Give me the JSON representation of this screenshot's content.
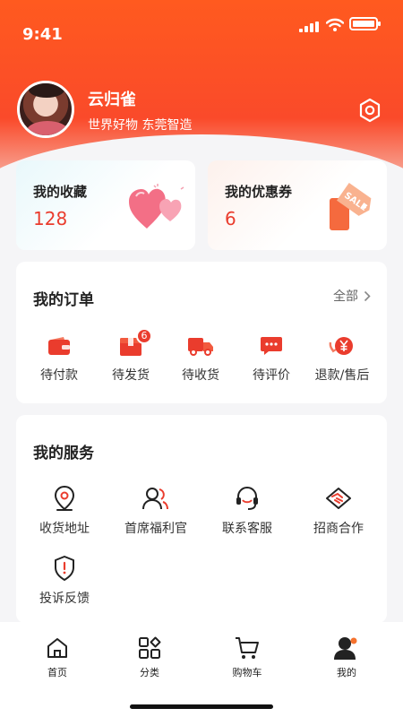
{
  "status_bar": {
    "time": "9:41"
  },
  "profile": {
    "name": "云归雀",
    "slogan": "世界好物 东莞智造"
  },
  "favorites": {
    "title": "我的收藏",
    "count": "128"
  },
  "coupons": {
    "title": "我的优惠券",
    "count": "6",
    "tag_text": "SALE"
  },
  "orders": {
    "title": "我的订单",
    "all_label": "全部",
    "items": [
      {
        "label": "待付款",
        "icon": "wallet-icon"
      },
      {
        "label": "待发货",
        "icon": "package-icon",
        "badge": "6"
      },
      {
        "label": "待收货",
        "icon": "truck-icon"
      },
      {
        "label": "待评价",
        "icon": "comment-icon"
      },
      {
        "label": "退款/售后",
        "icon": "refund-icon"
      }
    ]
  },
  "services": {
    "title": "我的服务",
    "items": [
      {
        "label": "收货地址",
        "icon": "location-pin-icon"
      },
      {
        "label": "首席福利官",
        "icon": "user-group-icon"
      },
      {
        "label": "联系客服",
        "icon": "headset-icon"
      },
      {
        "label": "招商合作",
        "icon": "handshake-icon"
      },
      {
        "label": "投诉反馈",
        "icon": "shield-alert-icon"
      }
    ]
  },
  "tabbar": {
    "items": [
      {
        "label": "首页",
        "icon": "home-icon"
      },
      {
        "label": "分类",
        "icon": "category-icon"
      },
      {
        "label": "购物车",
        "icon": "cart-icon"
      },
      {
        "label": "我的",
        "icon": "profile-icon",
        "active": true
      }
    ]
  },
  "colors": {
    "accent": "#ea3c2d",
    "header": "#fa4a2a"
  }
}
